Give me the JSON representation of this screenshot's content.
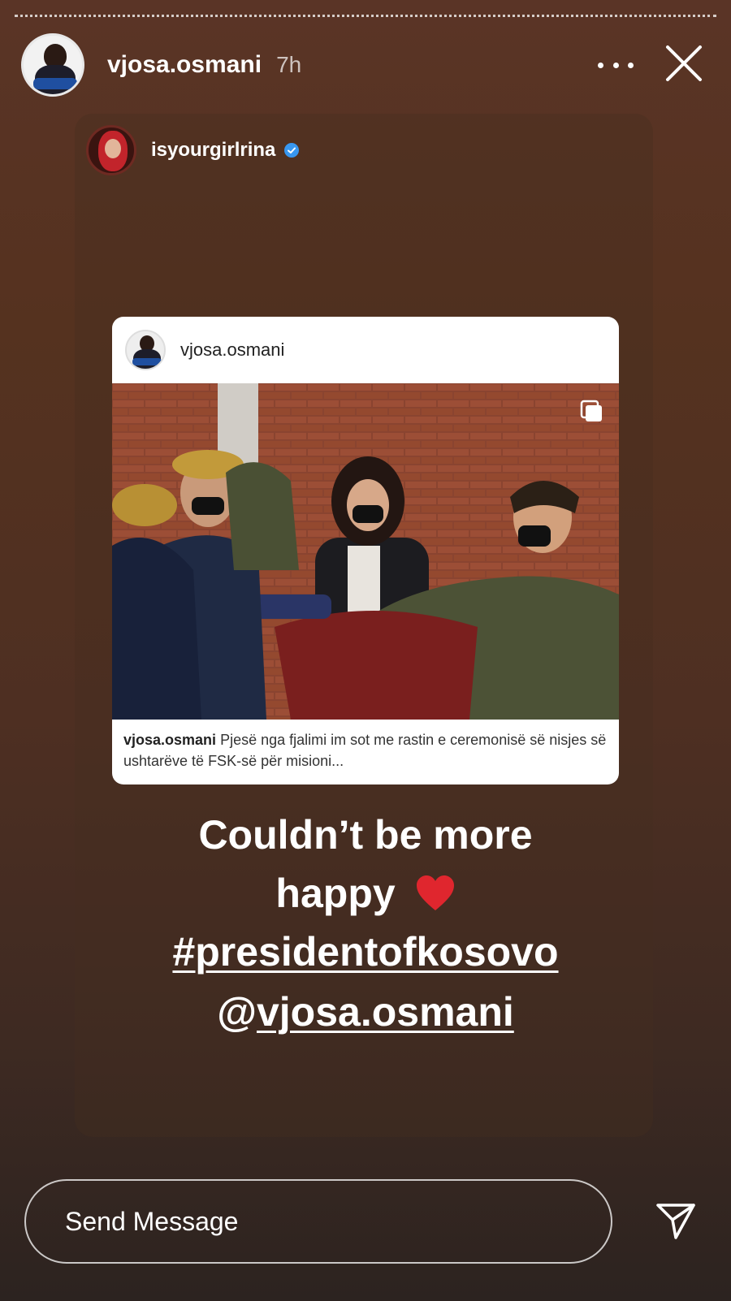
{
  "story": {
    "username": "vjosa.osmani",
    "time": "7h",
    "reshare": {
      "username": "isyourgirlrina"
    },
    "post": {
      "username": "vjosa.osmani",
      "caption_user": "vjosa.osmani",
      "caption_text": "Pjesë nga fjalimi im sot me rastin e ceremonisë së nisjes së ushtarëve të FSK-së për misioni..."
    },
    "text": {
      "line1": "Couldn’t be more",
      "line2": "happy",
      "hashtag": "#presidentofkosovo",
      "mention": "@vjosa.osmani"
    }
  },
  "footer": {
    "send_placeholder": "Send Message"
  },
  "icons": {
    "more": "more-horizontal-icon",
    "close": "close-icon",
    "verified": "verified-badge-icon",
    "multi": "multiple-images-icon",
    "heart": "red-heart-icon",
    "send": "send-icon"
  },
  "colors": {
    "verified": "#3897f0",
    "heart": "#e0262e"
  }
}
